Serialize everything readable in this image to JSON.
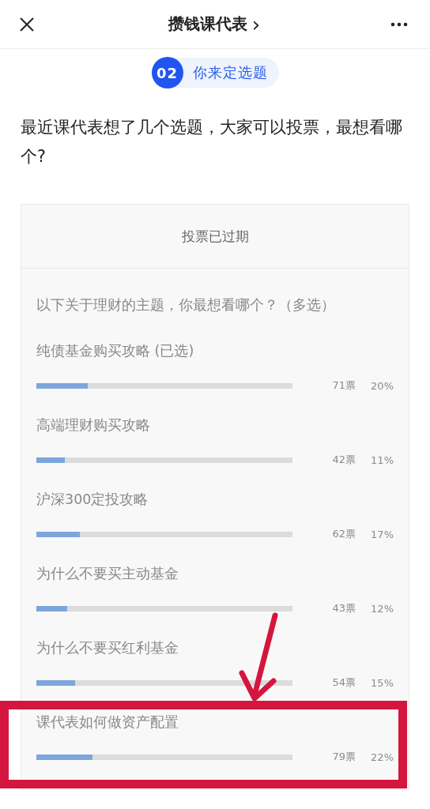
{
  "header": {
    "title": "攒钱课代表",
    "chevron": "›"
  },
  "section_badge": {
    "number": "02",
    "label": "你来定选题"
  },
  "intro": "最近课代表想了几个选题，大家可以投票，最想看哪个?",
  "poll": {
    "status": "投票已过期",
    "question": "以下关于理财的主题，你最想看哪个？（多选）",
    "options": [
      {
        "label": "纯债基金购买攻略 (已选)",
        "votes": "71票",
        "percent": "20%",
        "level": 0.2
      },
      {
        "label": "高端理财购买攻略",
        "votes": "42票",
        "percent": "11%",
        "level": 0.11
      },
      {
        "label": "沪深300定投攻略",
        "votes": "62票",
        "percent": "17%",
        "level": 0.17
      },
      {
        "label": "为什么不要买主动基金",
        "votes": "43票",
        "percent": "12%",
        "level": 0.12
      },
      {
        "label": "为什么不要买红利基金",
        "votes": "54票",
        "percent": "15%",
        "level": 0.15
      },
      {
        "label": "课代表如何做资产配置",
        "votes": "79票",
        "percent": "22%",
        "level": 0.22
      }
    ]
  },
  "annotations": {
    "arrow": true,
    "highlight_box": true
  }
}
